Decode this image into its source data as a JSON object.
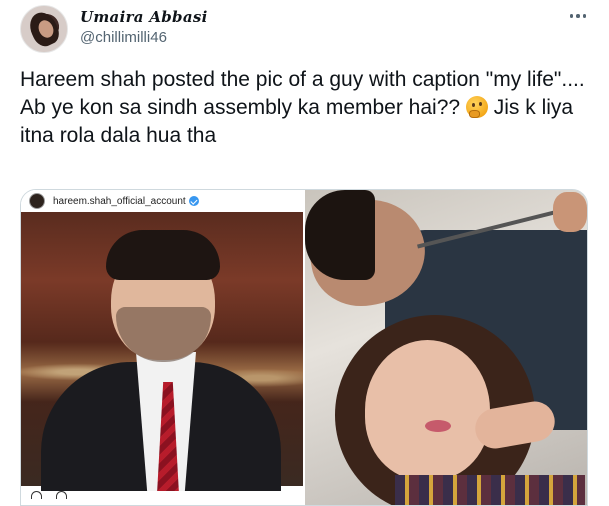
{
  "tweet": {
    "author": {
      "display_name": "Umaira Abbasi",
      "handle": "@chillimilli46"
    },
    "more_icon": "more-horizontal-icon",
    "text": {
      "line1": "Hareem shah posted the pic of a guy with caption \"my life\"....",
      "line2_before_emoji": "Ab ye kon sa sindh assembly ka member hai?? ",
      "emoji": "thinking-face-emoji",
      "line2_after_emoji": " Jis k liya itna rola dala hua tha"
    },
    "media": {
      "left_photo": {
        "instagram_account": "hareem.shah_official_account",
        "verified": true
      },
      "right_photo": {}
    }
  }
}
